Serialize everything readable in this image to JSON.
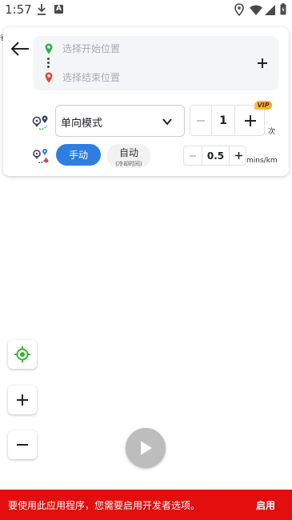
{
  "status_bar": {
    "time": "1:57",
    "icons": [
      "download-icon",
      "a-notification-icon",
      "location-icon",
      "wifi-icon",
      "signal-icon",
      "battery-icon"
    ]
  },
  "route": {
    "start_placeholder": "选择开始位置",
    "end_placeholder": "选择结束位置",
    "start_value": "",
    "end_value": ""
  },
  "mode": {
    "selected": "单向模式",
    "count_value": "1",
    "count_unit": "次",
    "vip_label": "VIP"
  },
  "control": {
    "manual_label": "手动",
    "auto_label": "自动",
    "auto_sublabel": "(冷却时间)",
    "speed_value": "0.5",
    "speed_unit": "mins/km"
  },
  "edge_text": "省",
  "banner": {
    "message": "要使用此应用程序，您需要启用开发者选项。",
    "action_label": "启用"
  },
  "colors": {
    "accent_blue": "#2f7de0",
    "banner_red": "#e30e0e",
    "start_pin": "#2bb24c",
    "end_pin": "#e0473a",
    "vip_gold": "#f3b431",
    "locate_green": "#35b534"
  }
}
